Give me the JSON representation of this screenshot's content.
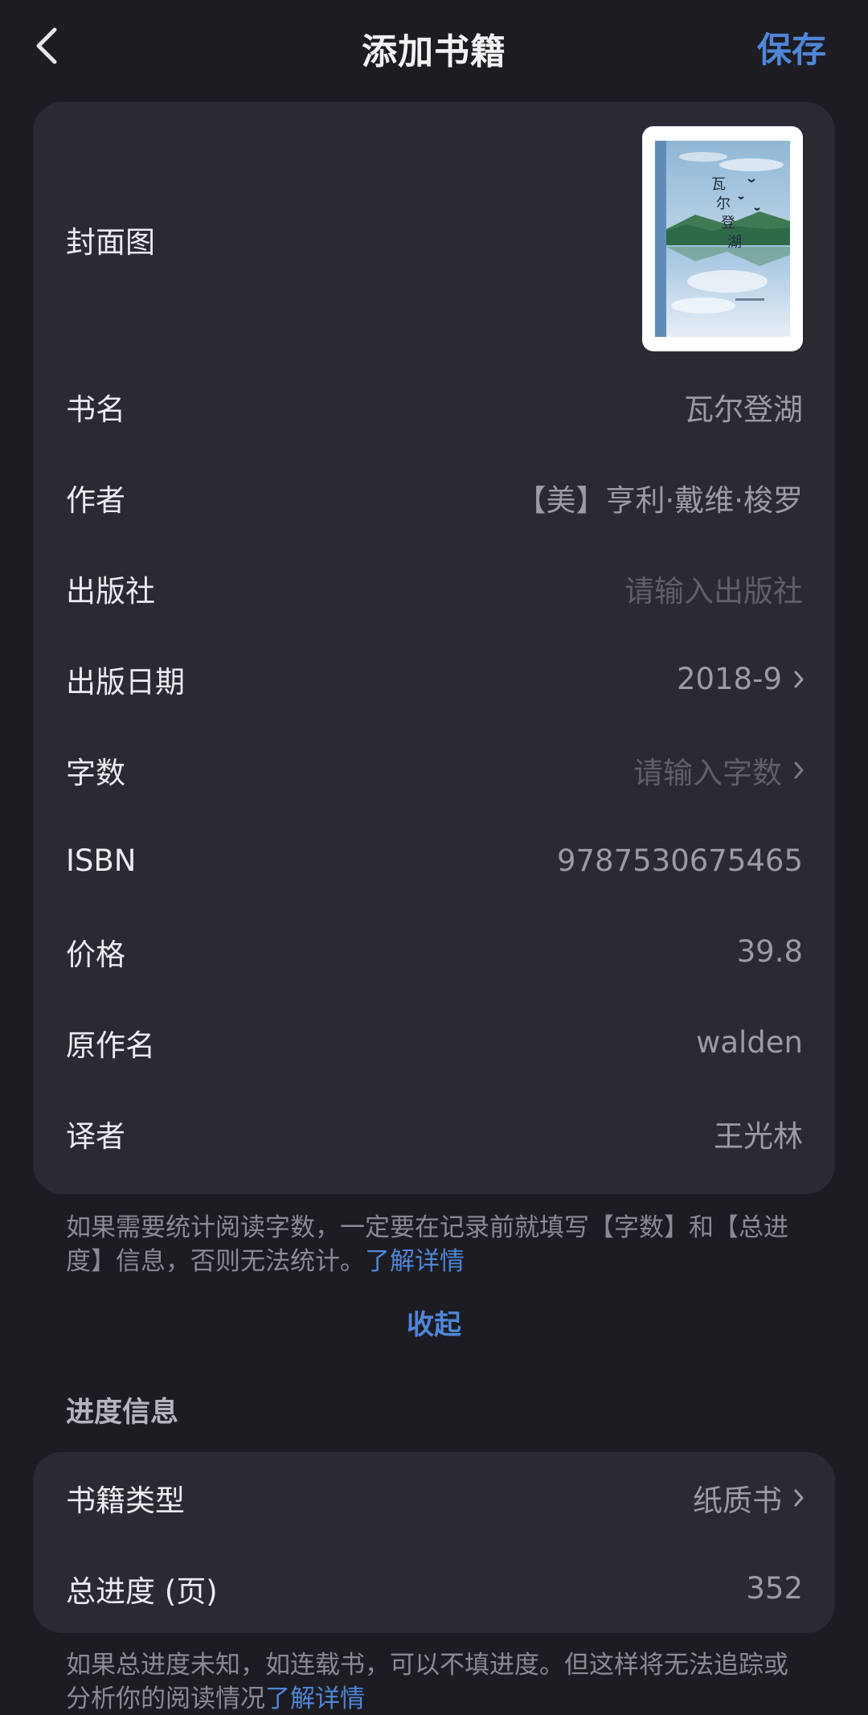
{
  "header": {
    "title": "添加书籍",
    "save_label": "保存"
  },
  "book": {
    "cover_label": "封面图",
    "cover_title": "瓦尔登湖",
    "rows": [
      {
        "label": "书名",
        "value": "瓦尔登湖"
      },
      {
        "label": "作者",
        "value": "【美】亨利·戴维·梭罗"
      },
      {
        "label": "出版社",
        "placeholder": "请输入出版社"
      },
      {
        "label": "出版日期",
        "value": "2018-9"
      },
      {
        "label": "字数",
        "placeholder": "请输入字数"
      },
      {
        "label": "ISBN",
        "value": "9787530675465"
      },
      {
        "label": "价格",
        "value": "39.8"
      },
      {
        "label": "原作名",
        "value": "walden"
      },
      {
        "label": "译者",
        "value": "王光林"
      }
    ]
  },
  "note1": {
    "text": "如果需要统计阅读字数，一定要在记录前就填写【字数】和【总进度】信息，否则无法统计。",
    "link": "了解详情"
  },
  "collapse_label": "收起",
  "progress": {
    "section_title": "进度信息",
    "rows": [
      {
        "label": "书籍类型",
        "value": "纸质书"
      },
      {
        "label": "总进度 (页)",
        "value": "352"
      }
    ]
  },
  "note2": {
    "text": "如果总进度未知，如连载书，可以不填进度。但这样将无法追踪或分析你的阅读情况",
    "link": "了解详情"
  },
  "colors": {
    "background": "#1c1c22",
    "card": "#2a2a33",
    "accent": "#4f86d8",
    "label": "#ececf0",
    "value": "#9b9ba4",
    "placeholder": "#5f5f68"
  }
}
